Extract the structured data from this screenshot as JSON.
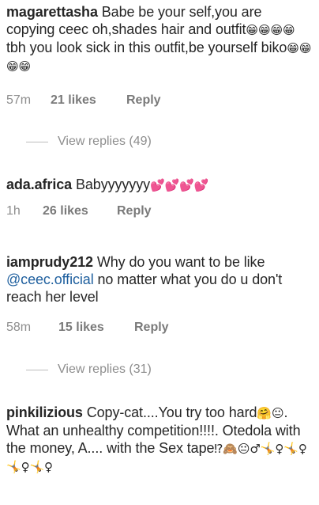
{
  "comments": [
    {
      "username": "magarettasha",
      "text": "Babe be your self,you are copying ceec oh,shades hair and outfit",
      "emoji1": "😁😁😁😁",
      "text2": "tbh you look sick in this outfit,be yourself biko",
      "emoji2": "😁😁😁😁",
      "time": "57m",
      "likes": "21 likes",
      "reply": "Reply",
      "view_replies": "View replies (49)"
    },
    {
      "username": "ada.africa",
      "text": "Babyyyyyyy",
      "emoji1": "💕💕💕💕",
      "time": "1h",
      "likes": "26 likes",
      "reply": "Reply"
    },
    {
      "username": "iamprudy212",
      "text": "Why do you want to be like",
      "mention": "@ceec.official",
      "text2": "no matter what you do u don't reach her level",
      "time": "58m",
      "likes": "15 likes",
      "reply": "Reply",
      "view_replies": "View replies (31)"
    },
    {
      "username": "pinkilizious",
      "text": "Copy-cat....You try too hard",
      "emoji1": "🤗😐",
      "text2": ". What an unhealthy competition!!!!. Otedola with the money, A.... with the Sex tape",
      "emoji2": "⁉🙈😐♂🤸♀🤸♀🤸♀🤸♀"
    }
  ]
}
